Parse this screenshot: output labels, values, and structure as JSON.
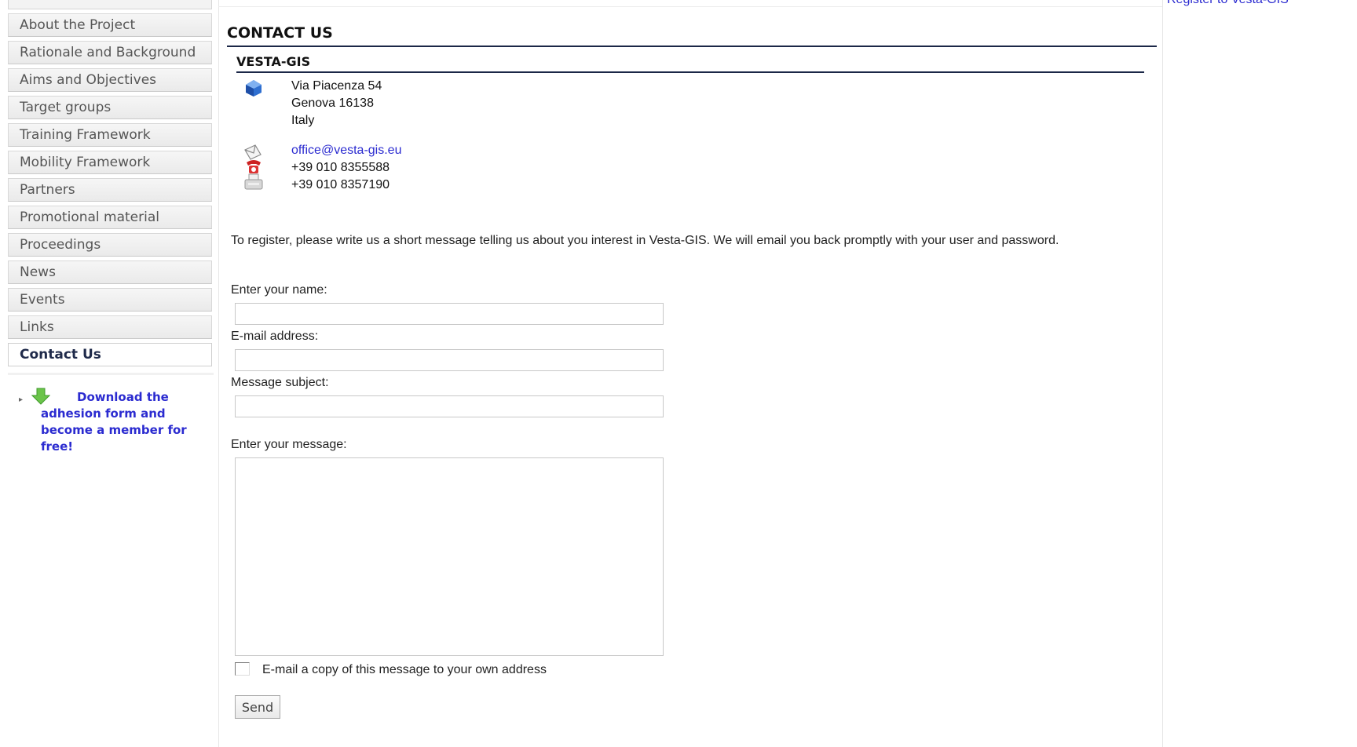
{
  "colors": {
    "link": "#2b2bd0",
    "rule": "#1b2747",
    "nav_bg": "#f0f0f0",
    "nav_text": "#555555",
    "active_nav_text": "#1f2a4a",
    "download_arrow": "#6bc44a"
  },
  "sidebar": {
    "items": [
      {
        "label": "About the Project"
      },
      {
        "label": "Rationale and Background"
      },
      {
        "label": "Aims and Objectives"
      },
      {
        "label": "Target groups"
      },
      {
        "label": "Training Framework"
      },
      {
        "label": "Mobility Framework"
      },
      {
        "label": "Partners"
      },
      {
        "label": "Promotional material"
      },
      {
        "label": "Proceedings"
      },
      {
        "label": "News"
      },
      {
        "label": "Events"
      },
      {
        "label": "Links"
      },
      {
        "label": "Contact Us",
        "active": true
      }
    ],
    "download": {
      "icon": "green-down-arrow-icon",
      "text": "Download the adhesion form and become a member for free!"
    }
  },
  "right_column": {
    "link": "Register to Vesta-GIS"
  },
  "main": {
    "title": "CONTACT US",
    "company": "VESTA-GIS",
    "address": {
      "icon": "house-icon",
      "street": "Via Piacenza 54",
      "city": "Genova 16138",
      "country": "Italy"
    },
    "contact": {
      "email_icon": "mail-icon",
      "phone_icon": "phone-icon",
      "fax_icon": "fax-icon",
      "email": "office@vesta-gis.eu",
      "phone": "+39 010 8355588",
      "fax": "+39 010 8357190"
    },
    "intro": "To register, please write us a short message telling us about you interest in Vesta-GIS. We will email you back promptly with your user and password.",
    "form": {
      "name_label": "Enter your name:",
      "name_value": "",
      "email_label": "E-mail address:",
      "email_value": "",
      "subject_label": "Message subject:",
      "subject_value": "",
      "message_label": "Enter your message:",
      "message_value": "",
      "copy_label": "E-mail a copy of this message to your own address",
      "copy_checked": false,
      "send_label": "Send"
    }
  }
}
